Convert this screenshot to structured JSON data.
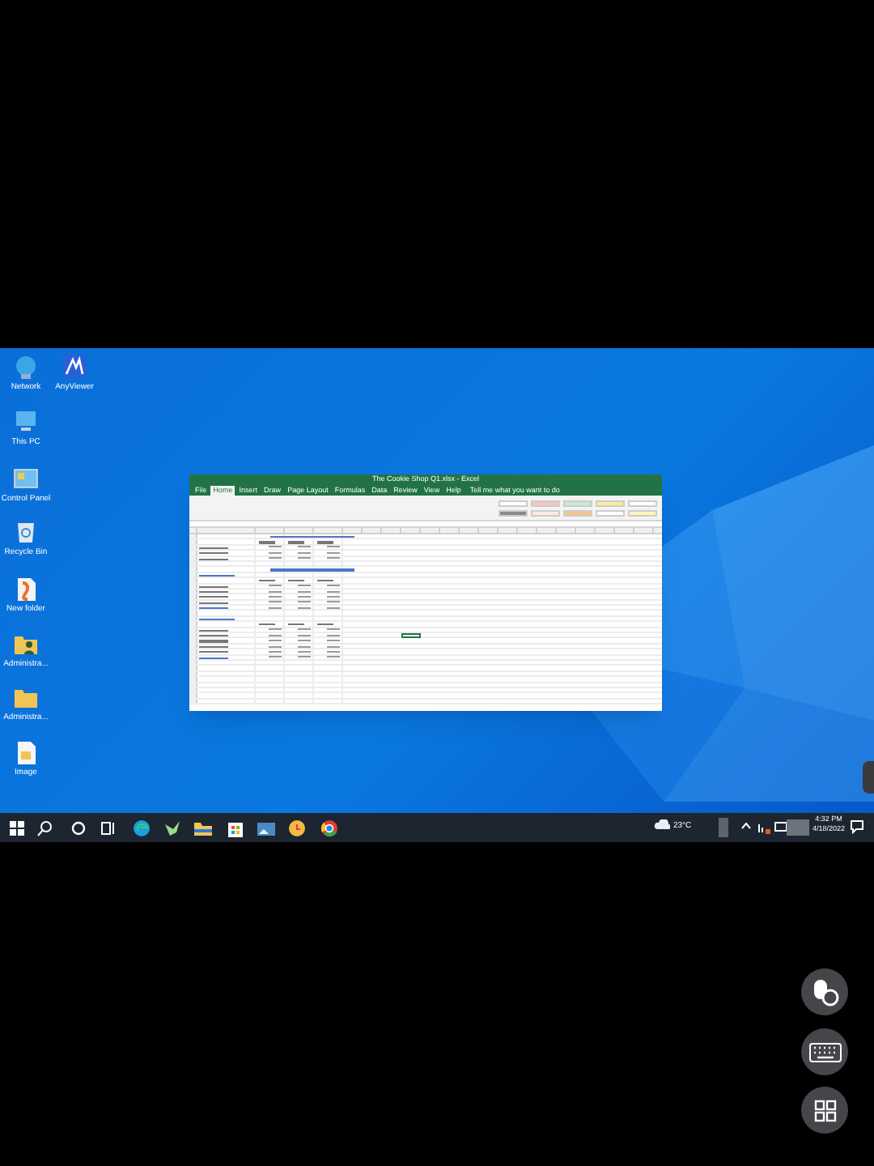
{
  "desktop_icons": [
    {
      "label": "Network",
      "kind": "network"
    },
    {
      "label": "AnyViewer",
      "kind": "anyviewer"
    },
    {
      "label": "This PC",
      "kind": "pc"
    },
    {
      "label": "Control Panel",
      "kind": "control"
    },
    {
      "label": "Recycle Bin",
      "kind": "bin"
    },
    {
      "label": "New folder",
      "kind": "doc"
    },
    {
      "label": "Administra...",
      "kind": "userfolder"
    },
    {
      "label": "Administra...",
      "kind": "folder"
    },
    {
      "label": "Image",
      "kind": "file"
    }
  ],
  "excel": {
    "title": "The Cookie Shop Q1.xlsx - Excel",
    "ribbon_tabs": [
      {
        "label": "File",
        "selected": false
      },
      {
        "label": "Home",
        "selected": true
      },
      {
        "label": "Insert",
        "selected": false
      },
      {
        "label": "Draw",
        "selected": false
      },
      {
        "label": "Page Layout",
        "selected": false
      },
      {
        "label": "Formulas",
        "selected": false
      },
      {
        "label": "Data",
        "selected": false
      },
      {
        "label": "Review",
        "selected": false
      },
      {
        "label": "View",
        "selected": false
      },
      {
        "label": "Help",
        "selected": false
      }
    ],
    "tell_me": "Tell me what you want to do",
    "rows": [
      {
        "kind": "title"
      },
      {
        "kind": "months"
      },
      {
        "kind": "data"
      },
      {
        "kind": "data"
      },
      {
        "kind": "data"
      },
      {
        "kind": "empty"
      },
      {
        "kind": "title"
      },
      {
        "kind": "section"
      },
      {
        "kind": "months"
      },
      {
        "kind": "data"
      },
      {
        "kind": "data"
      },
      {
        "kind": "data"
      },
      {
        "kind": "data"
      },
      {
        "kind": "total"
      },
      {
        "kind": "empty"
      },
      {
        "kind": "section"
      },
      {
        "kind": "months"
      },
      {
        "kind": "data"
      },
      {
        "kind": "data"
      },
      {
        "kind": "data"
      },
      {
        "kind": "data"
      },
      {
        "kind": "data"
      },
      {
        "kind": "total"
      }
    ]
  },
  "tray": {
    "weather": "23°C",
    "time": "4:32 PM",
    "date": "4/18/2022"
  }
}
